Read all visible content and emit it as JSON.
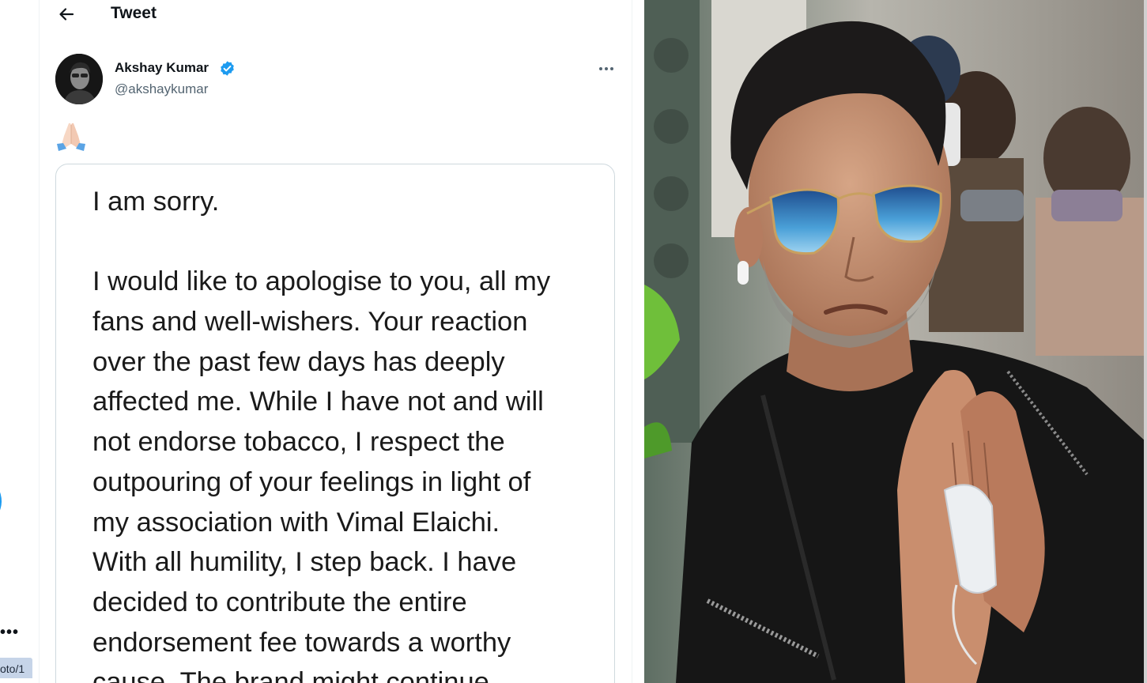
{
  "browser": {
    "url_fragment": "oto/1"
  },
  "header": {
    "title": "Tweet"
  },
  "author": {
    "name": "Akshay Kumar",
    "handle": "@akshaykumar",
    "verified": true
  },
  "tweet": {
    "text_emoji": "🙏🏻",
    "image_lines": [
      "I am sorry.",
      "",
      "I would like to apologise to you, all my",
      "fans and well-wishers. Your reaction",
      "over the past few days has deeply",
      "affected me. While I have not and will",
      "not endorse tobacco, I respect the",
      "outpouring of your feelings in light of",
      "my association with Vimal Elaichi.",
      "With all humility, I step back. I have",
      "decided to contribute the entire",
      "endorsement fee towards a worthy",
      "cause. The brand might continue"
    ]
  },
  "colors": {
    "accent_blue": "#1d9bf0",
    "text_primary": "#0f1419",
    "text_secondary": "#536471",
    "border": "#cfd9de"
  },
  "icons": {
    "back": "arrow-left-icon",
    "verified": "verified-badge-icon",
    "more": "more-dots-icon"
  }
}
